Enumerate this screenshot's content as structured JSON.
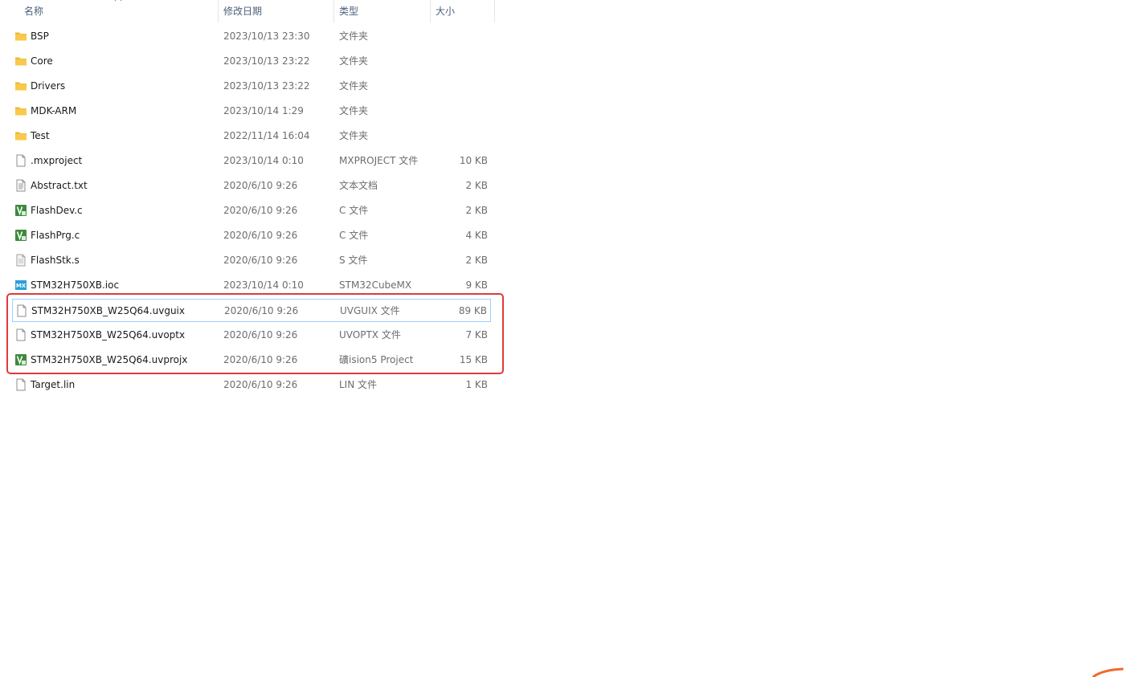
{
  "columns": {
    "name": "名称",
    "date": "修改日期",
    "type": "类型",
    "size": "大小"
  },
  "sort_indicator": "ascending",
  "files": [
    {
      "name": "BSP",
      "date": "2023/10/13 23:30",
      "type": "文件夹",
      "size": "",
      "icon": "folder-icon"
    },
    {
      "name": "Core",
      "date": "2023/10/13 23:22",
      "type": "文件夹",
      "size": "",
      "icon": "folder-icon"
    },
    {
      "name": "Drivers",
      "date": "2023/10/13 23:22",
      "type": "文件夹",
      "size": "",
      "icon": "folder-icon"
    },
    {
      "name": "MDK-ARM",
      "date": "2023/10/14 1:29",
      "type": "文件夹",
      "size": "",
      "icon": "folder-icon"
    },
    {
      "name": "Test",
      "date": "2022/11/14 16:04",
      "type": "文件夹",
      "size": "",
      "icon": "folder-icon"
    },
    {
      "name": ".mxproject",
      "date": "2023/10/14 0:10",
      "type": "MXPROJECT 文件",
      "size": "10 KB",
      "icon": "blank-file-icon"
    },
    {
      "name": "Abstract.txt",
      "date": "2020/6/10 9:26",
      "type": "文本文档",
      "size": "2 KB",
      "icon": "text-file-icon"
    },
    {
      "name": "FlashDev.c",
      "date": "2020/6/10 9:26",
      "type": "C 文件",
      "size": "2 KB",
      "icon": "keil-file-icon"
    },
    {
      "name": "FlashPrg.c",
      "date": "2020/6/10 9:26",
      "type": "C 文件",
      "size": "4 KB",
      "icon": "keil-file-icon"
    },
    {
      "name": "FlashStk.s",
      "date": "2020/6/10 9:26",
      "type": "S 文件",
      "size": "2 KB",
      "icon": "asm-file-icon"
    },
    {
      "name": "STM32H750XB.ioc",
      "date": "2023/10/14 0:10",
      "type": "STM32CubeMX",
      "size": "9 KB",
      "icon": "cubemx-file-icon"
    },
    {
      "name": "STM32H750XB_W25Q64.uvguix",
      "date": "2020/6/10 9:26",
      "type": "UVGUIX 文件",
      "size": "89 KB",
      "icon": "blank-file-icon",
      "selected": true
    },
    {
      "name": "STM32H750XB_W25Q64.uvoptx",
      "date": "2020/6/10 9:26",
      "type": "UVOPTX 文件",
      "size": "7 KB",
      "icon": "blank-file-icon"
    },
    {
      "name": "STM32H750XB_W25Q64.uvprojx",
      "date": "2020/6/10 9:26",
      "type": "礦ision5 Project",
      "size": "15 KB",
      "icon": "keil-file-icon"
    },
    {
      "name": "Target.lin",
      "date": "2020/6/10 9:26",
      "type": "LIN 文件",
      "size": "1 KB",
      "icon": "blank-file-icon"
    }
  ],
  "colors": {
    "highlight_border": "#e03a3a",
    "selection_border": "#99d1ff",
    "folder": "#f8c94a",
    "keil_green": "#3c8a3c",
    "cubemx_blue": "#2aa0d8"
  }
}
